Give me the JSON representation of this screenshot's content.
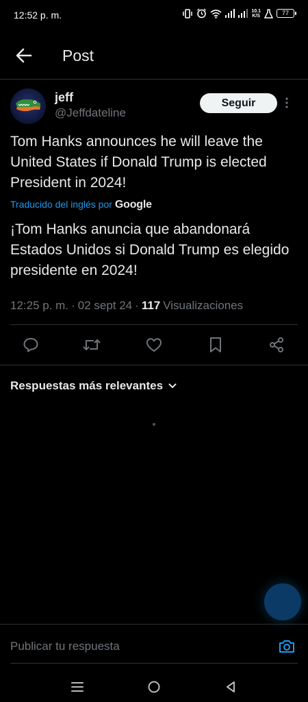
{
  "status_bar": {
    "time": "12:52 p. m.",
    "network_speed_top": "10.1",
    "network_speed_unit": "K/S",
    "battery": "77",
    "icons": [
      "vibrate-icon",
      "alarm-icon",
      "wifi-icon",
      "signal-icon",
      "signal-icon",
      "network-speed",
      "flask-icon",
      "battery-icon"
    ]
  },
  "header": {
    "title": "Post",
    "back_icon": "arrow-left-icon"
  },
  "post": {
    "author": {
      "display_name": "jeff",
      "handle": "@Jeffdateline",
      "avatar": "gator-logo"
    },
    "follow_label": "Seguir",
    "text": "Tom Hanks announces he will leave the United States if Donald Trump is elected President in 2024!",
    "translated_by": "Traducido del inglés por",
    "translator": "Google",
    "translation": "¡Tom Hanks anuncia que abandonará Estados Unidos si Donald Trump es elegido presidente en 2024!",
    "time": "12:25 p. m.",
    "separator": "·",
    "date": "02 sept 24",
    "views_count": "117",
    "views_label": "Visualizaciones"
  },
  "actions": [
    "reply-icon",
    "repost-icon",
    "like-icon",
    "bookmark-icon",
    "share-icon"
  ],
  "replies": {
    "sort_label": "Respuestas más relevantes"
  },
  "reply_bar": {
    "placeholder": "Publicar tu respuesta"
  },
  "colors": {
    "background": "#000000",
    "text": "#e7e9ea",
    "muted": "#71767b",
    "accent": "#1d9bf0",
    "divider": "#2f3336",
    "follow_bg": "#eff3f4"
  }
}
